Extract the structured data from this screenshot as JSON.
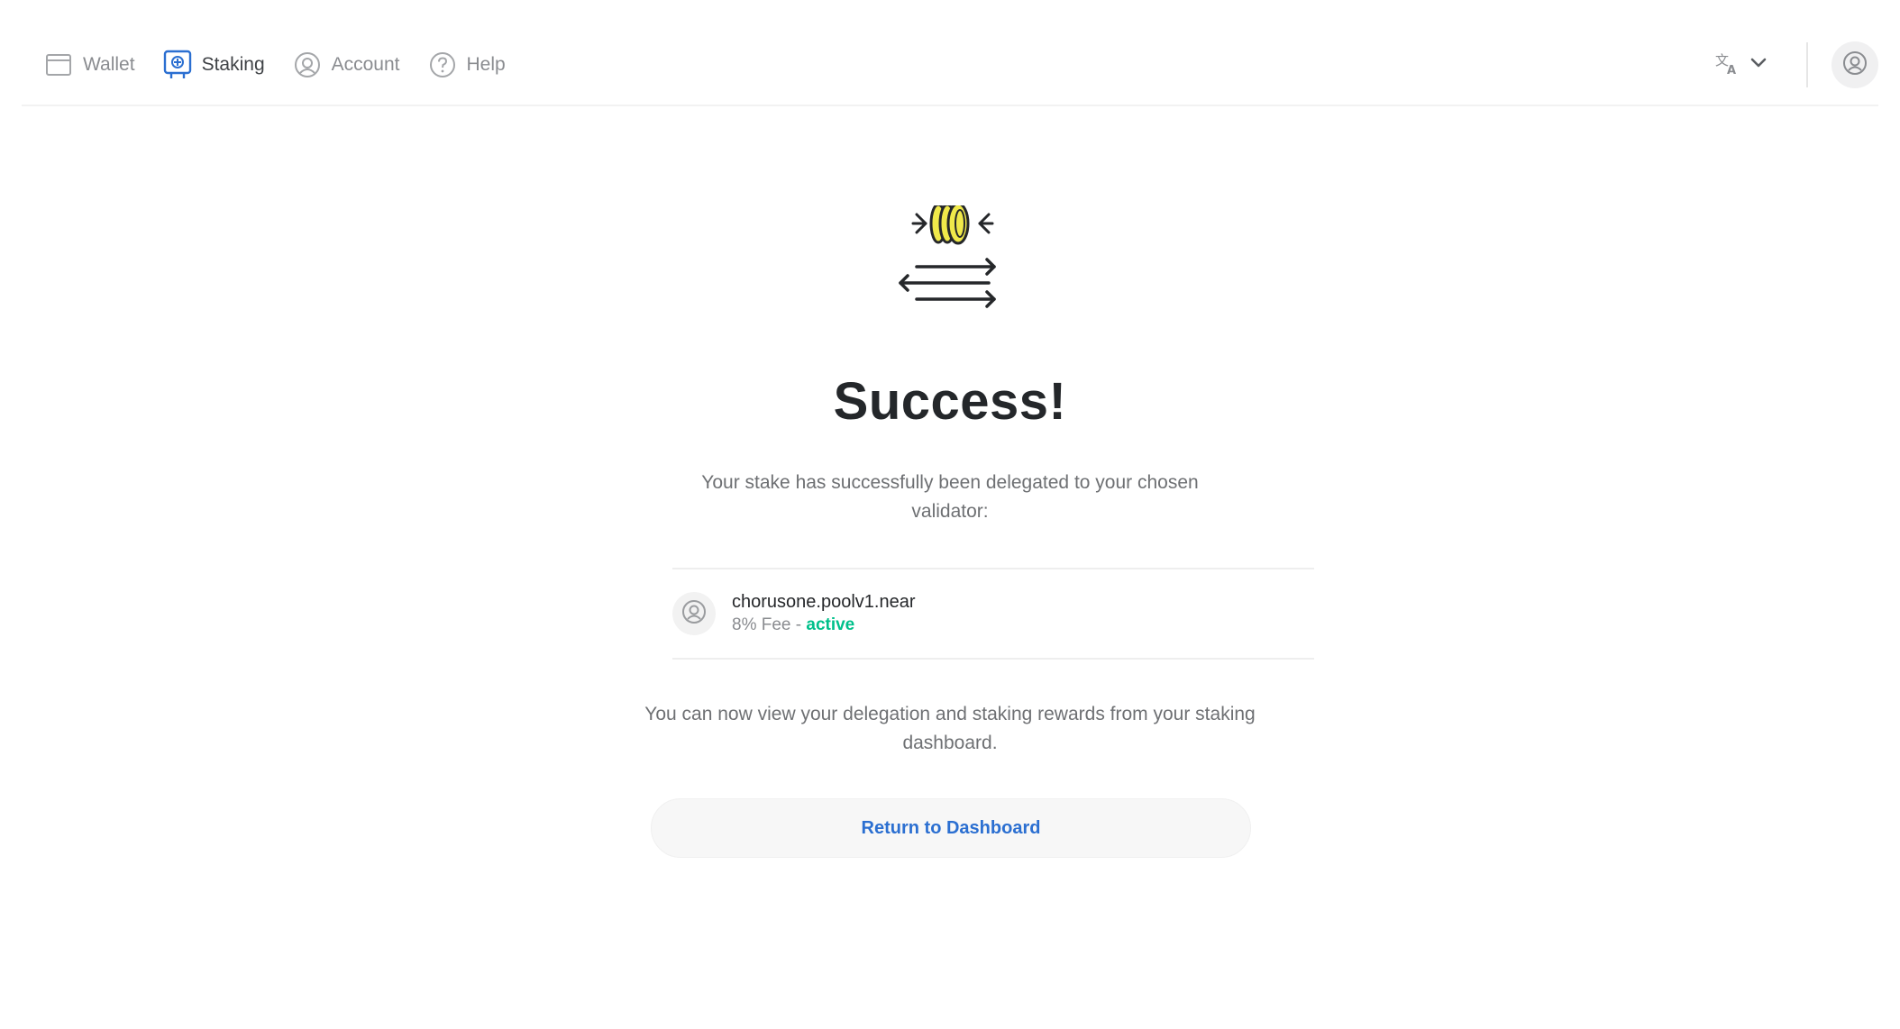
{
  "nav": {
    "items": [
      {
        "label": "Wallet",
        "icon": "wallet-icon",
        "active": false
      },
      {
        "label": "Staking",
        "icon": "staking-icon",
        "active": true
      },
      {
        "label": "Account",
        "icon": "account-icon",
        "active": false
      },
      {
        "label": "Help",
        "icon": "help-icon",
        "active": false
      }
    ],
    "language_icon": "translate-icon",
    "user_icon": "user-avatar-icon"
  },
  "main": {
    "illustration": "coins-transfer-illustration",
    "title": "Success!",
    "description": "Your stake has successfully been delegated to your chosen validator:",
    "validator": {
      "name": "chorusone.poolv1.near",
      "fee": "8% Fee - ",
      "status": "active"
    },
    "info": "You can now view your delegation and staking rewards from your staking dashboard.",
    "return_button": "Return to Dashboard"
  },
  "colors": {
    "accent_blue": "#2b6fd1",
    "active_green": "#00c08b",
    "coin_yellow": "#f0e94a"
  }
}
